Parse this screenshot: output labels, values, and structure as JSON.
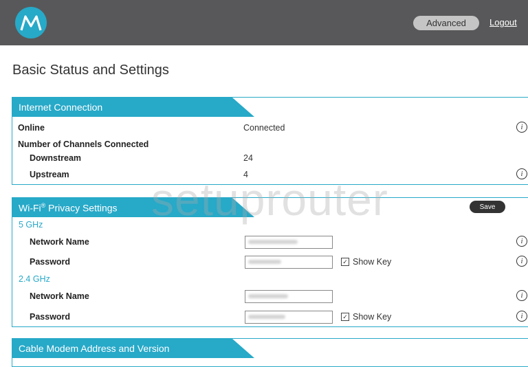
{
  "header": {
    "advanced_label": "Advanced",
    "logout_label": "Logout",
    "logo_icon": "motorola-logo-icon"
  },
  "page_title": "Basic Status and Settings",
  "internet": {
    "title": "Internet Connection",
    "online_label": "Online",
    "online_value": "Connected",
    "channels_label": "Number of Channels Connected",
    "downstream_label": "Downstream",
    "downstream_value": "24",
    "upstream_label": "Upstream",
    "upstream_value": "4"
  },
  "wifi": {
    "title_pre": "Wi-Fi",
    "title_sup": "®",
    "title_post": " Privacy Settings",
    "save_label": "Save",
    "band_5": "5 GHz",
    "band_24": "2.4 GHz",
    "network_name_label": "Network Name",
    "password_label": "Password",
    "show_key_label": "Show Key"
  },
  "cable_modem": {
    "title": "Cable Modem Address and Version"
  },
  "watermark": "setuprouter",
  "colors": {
    "accent": "#27a9c8",
    "header": "#58585a"
  }
}
